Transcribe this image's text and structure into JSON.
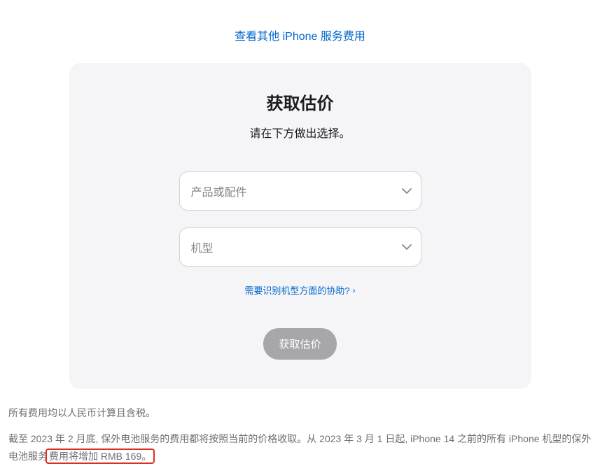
{
  "topLink": {
    "text": "查看其他 iPhone 服务费用"
  },
  "card": {
    "title": "获取估价",
    "subtitle": "请在下方做出选择。",
    "select1": {
      "placeholder": "产品或配件"
    },
    "select2": {
      "placeholder": "机型"
    },
    "helpLink": {
      "text": "需要识别机型方面的协助?"
    },
    "submit": {
      "label": "获取估价"
    }
  },
  "footer": {
    "line1": "所有费用均以人民币计算且含税。",
    "line2_part1": "截至 2023 年 2 月底, 保外电池服务的费用都将按照当前的价格收取。从 2023 年 3 月 1 日起, iPhone 14 之前的所有 iPhone 机型的保外电池服务",
    "line2_part2": "费用将增加 RMB 169。"
  }
}
